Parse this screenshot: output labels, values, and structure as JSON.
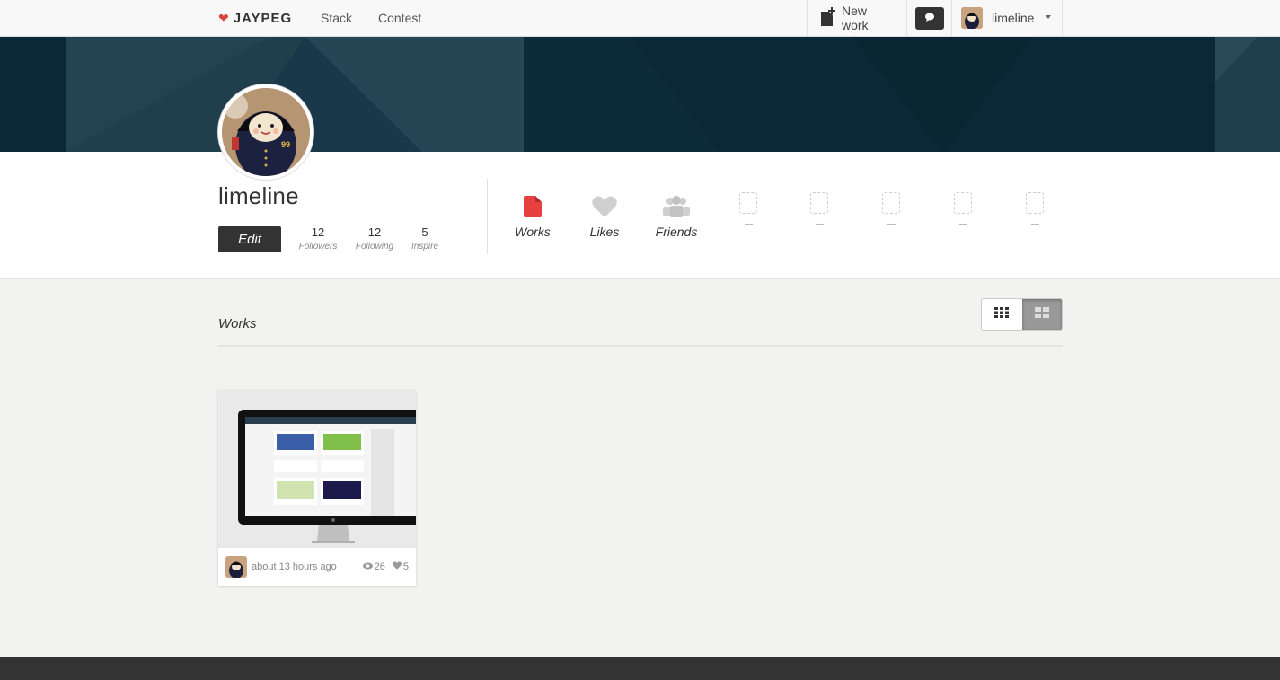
{
  "nav": {
    "brand": "JAYPEG",
    "links": [
      "Stack",
      "Contest"
    ],
    "new_work": "New work",
    "user": "limeline"
  },
  "profile": {
    "username": "limeline",
    "edit_label": "Edit",
    "stats": [
      {
        "value": "12",
        "label": "Followers"
      },
      {
        "value": "12",
        "label": "Following"
      },
      {
        "value": "5",
        "label": "Inspire"
      }
    ],
    "tabs": [
      {
        "label": "Works",
        "icon": "document-icon",
        "color": "#e84040"
      },
      {
        "label": "Likes",
        "icon": "heart-icon",
        "color": "#cccccc"
      },
      {
        "label": "Friends",
        "icon": "people-icon",
        "color": "#cccccc"
      }
    ],
    "empty_slots": [
      "---",
      "---",
      "---",
      "---",
      "---"
    ]
  },
  "works": {
    "title": "Works",
    "items": [
      {
        "time": "about 13 hours ago",
        "views": "26",
        "likes": "5"
      }
    ]
  },
  "colors": {
    "banner": "#0b2836",
    "accent": "#e84040",
    "button_dark": "#333333"
  }
}
